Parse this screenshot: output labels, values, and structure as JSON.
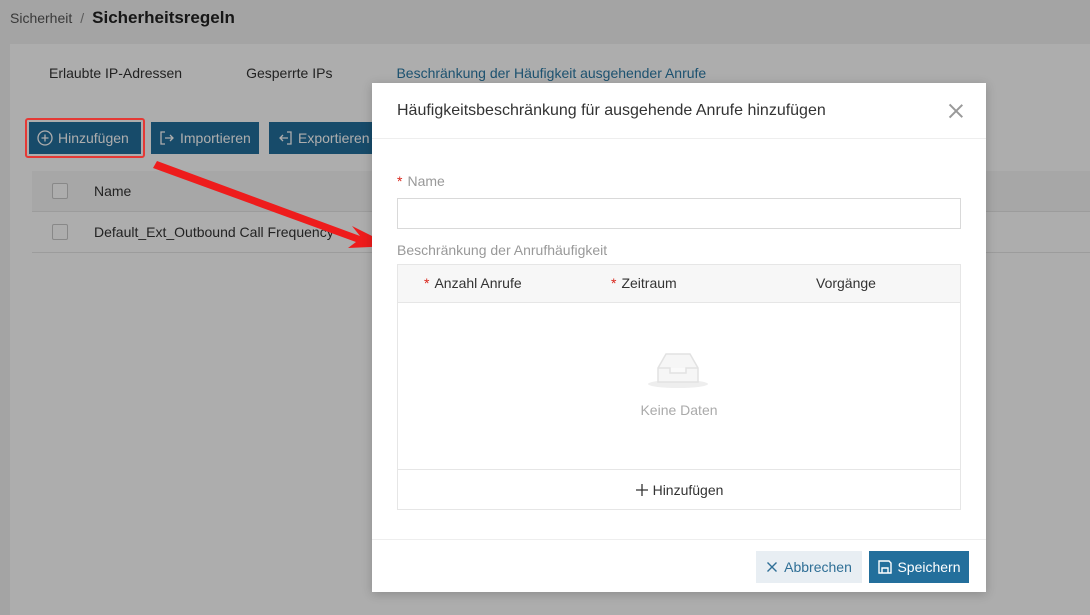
{
  "breadcrumb": {
    "parent": "Sicherheit",
    "separator": "/",
    "title": "Sicherheitsregeln"
  },
  "tabs": [
    {
      "label": "Erlaubte IP-Adressen",
      "active": false
    },
    {
      "label": "Gesperrte IPs",
      "active": false
    },
    {
      "label": "Beschränkung der Häufigkeit ausgehender Anrufe",
      "active": true
    }
  ],
  "toolbar": {
    "add_label": "Hinzufügen",
    "import_label": "Importieren",
    "export_label": "Exportieren"
  },
  "table": {
    "columns": [
      "Name"
    ],
    "rows": [
      {
        "name": "Default_Ext_Outbound Call Frequency"
      }
    ]
  },
  "modal": {
    "title": "Häufigkeitsbeschränkung für ausgehende Anrufe hinzufügen",
    "name_label": "Name",
    "name_value": "",
    "freq_label": "Beschränkung der Anrufhäufigkeit",
    "freq_columns": {
      "calls": "Anzahl Anrufe",
      "period": "Zeitraum",
      "actions": "Vorgänge"
    },
    "empty_text": "Keine Daten",
    "add_row_label": "Hinzufügen",
    "cancel_label": "Abbrechen",
    "save_label": "Speichern"
  },
  "colors": {
    "primary": "#236f9c",
    "annotation_red": "#e53935",
    "required": "#d9241a"
  }
}
